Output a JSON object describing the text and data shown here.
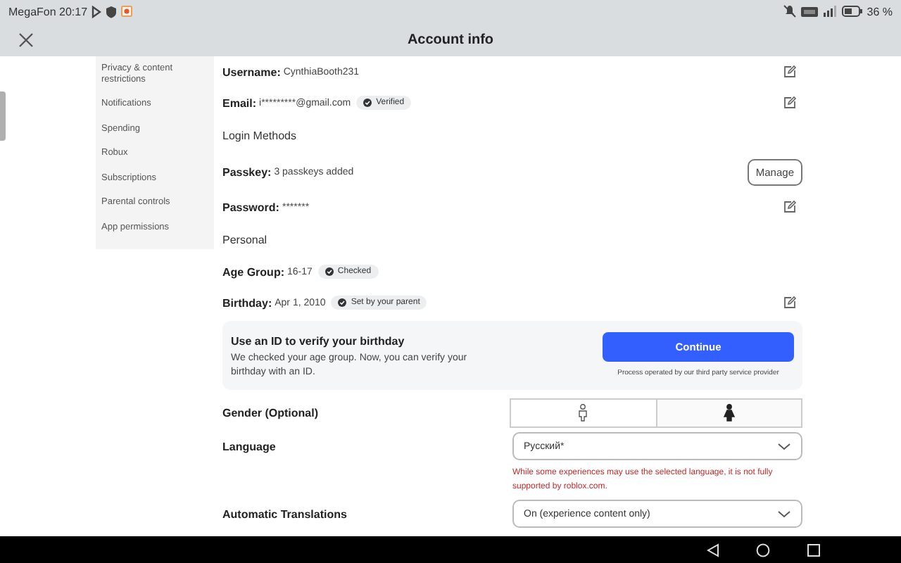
{
  "status_bar": {
    "carrier_time": "MegaFon 20:17",
    "battery": "36 %"
  },
  "header": {
    "title": "Account info"
  },
  "sidebar": {
    "items": [
      {
        "label": "Privacy & content restrictions"
      },
      {
        "label": "Notifications"
      },
      {
        "label": "Spending"
      },
      {
        "label": "Robux"
      },
      {
        "label": "Subscriptions"
      },
      {
        "label": "Parental controls"
      },
      {
        "label": "App permissions"
      }
    ]
  },
  "content": [
    {
      "kind": "field",
      "label": "Username:",
      "value": "CynthiaBooth231",
      "editable": true
    },
    {
      "kind": "field",
      "label": "Email:",
      "value": "i*********@gmail.com",
      "badge": "Verified",
      "editable": true
    },
    {
      "kind": "heading",
      "text": "Login Methods"
    },
    {
      "kind": "field",
      "label": "Passkey:",
      "value": "3 passkeys added",
      "button": "Manage",
      "editable": false
    },
    {
      "kind": "field",
      "label": "Password:",
      "value": "*******",
      "editable": true
    },
    {
      "kind": "heading",
      "text": "Personal"
    },
    {
      "kind": "field",
      "label": "Age Group:",
      "value": "16-17",
      "badge": "Checked",
      "editable": false
    },
    {
      "kind": "field",
      "label": "Birthday:",
      "value": "Apr 1, 2010",
      "badge": "Set by your parent",
      "editable": true
    },
    {
      "kind": "card",
      "title": "Use an ID to verify your birthday",
      "text": "We checked your age group. Now, you can verify your birthday with an ID.",
      "button": "Continue",
      "note": "Process operated by our third party service provider"
    },
    {
      "kind": "gender",
      "label": "Gender (Optional)",
      "options": [
        {
          "kind": "male",
          "selected": false
        },
        {
          "kind": "female",
          "selected": true
        }
      ]
    },
    {
      "kind": "dropdown",
      "label": "Language",
      "value": "Русский*",
      "warning": "While some experiences may use the selected language, it is not fully supported by roblox.com."
    },
    {
      "kind": "dropdown",
      "label": "Automatic Translations",
      "value": "On (experience content only)"
    }
  ]
}
